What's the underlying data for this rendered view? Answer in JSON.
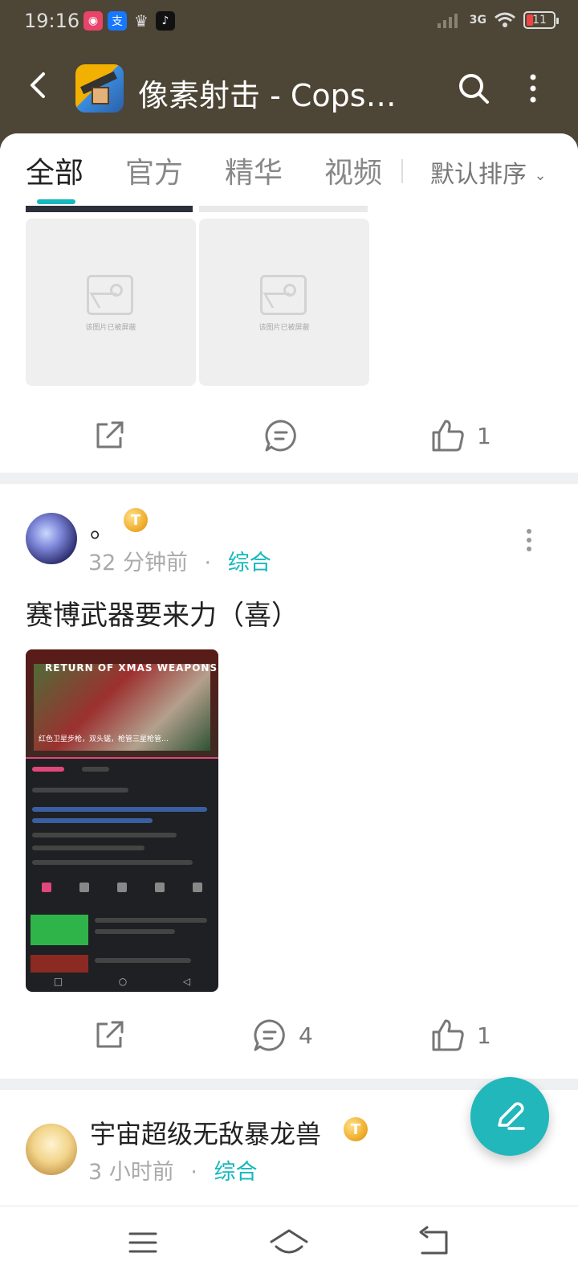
{
  "status_bar": {
    "time": "19:16",
    "network": "3G",
    "battery": "11",
    "icons": [
      "app-icon",
      "alipay-icon",
      "crown-icon",
      "tiktok-icon",
      "signal-icon",
      "wifi-icon",
      "battery-icon"
    ]
  },
  "header": {
    "title": "像素射击 - Cops…",
    "icons": [
      "back-arrow-icon",
      "app-logo",
      "search-icon",
      "more-vertical-icon"
    ]
  },
  "tabs": [
    {
      "label": "全部",
      "active": true
    },
    {
      "label": "官方",
      "active": false
    },
    {
      "label": "精华",
      "active": false
    },
    {
      "label": "视频",
      "active": false
    }
  ],
  "sort": {
    "label": "默认排序"
  },
  "post1": {
    "blocked_caption": "该图片已被屏蔽",
    "like_count": "1"
  },
  "post2": {
    "username": "。",
    "badge": "T",
    "time": "32 分钟前",
    "separator": "·",
    "category": "综合",
    "body": "赛博武器要来力（喜）",
    "screenshot": {
      "video_title": "RETURN OF XMAS WEAPONS",
      "video_subtitle": "红色卫星步枪，双头锯，枪管三星枪管…"
    },
    "comment_count": "4",
    "like_count": "1"
  },
  "post3": {
    "username": "宇宙超级无敌暴龙兽",
    "badge": "T",
    "time": "3 小时前",
    "separator": "·",
    "category": "综合"
  },
  "colors": {
    "header_bg": "#4d4535",
    "accent": "#16b8bd",
    "fab": "#22b7bb"
  }
}
